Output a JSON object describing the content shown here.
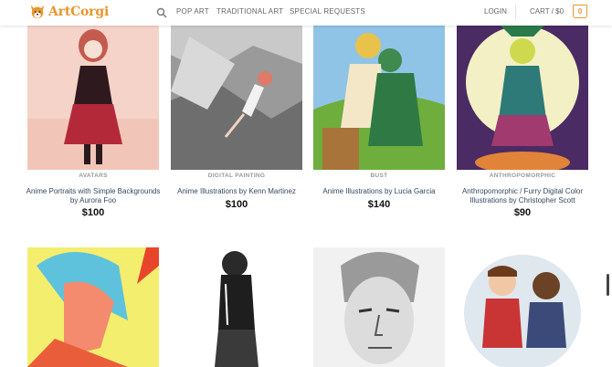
{
  "brand": {
    "name": "ArtCorgi"
  },
  "nav": {
    "items": [
      "POP ART",
      "TRADITIONAL ART",
      "SPECIAL REQUESTS"
    ],
    "login": "LOGIN",
    "cart": "CART / $0",
    "cart_count": "0"
  },
  "colors": {
    "accent": "#e8972c",
    "link": "#334862"
  },
  "products": [
    {
      "category": "AVATARS",
      "title": "Anime Portraits with Simple Backgrounds by Aurora Foo",
      "price": "$100"
    },
    {
      "category": "DIGITAL PAINTING",
      "title": "Anime Illustrations by Kenn Martinez",
      "price": "$100"
    },
    {
      "category": "BUST",
      "title": "Anime Illustrations by Lucia Garcia",
      "price": "$140"
    },
    {
      "category": "ANTHROPOMORPHIC",
      "title": "Anthropomorphic / Furry Digital Color Illustrations by Christopher Scott",
      "price": "$90"
    },
    {
      "category": "",
      "title": "",
      "price": ""
    },
    {
      "category": "",
      "title": "",
      "price": ""
    },
    {
      "category": "",
      "title": "",
      "price": ""
    },
    {
      "category": "",
      "title": "",
      "price": ""
    }
  ]
}
